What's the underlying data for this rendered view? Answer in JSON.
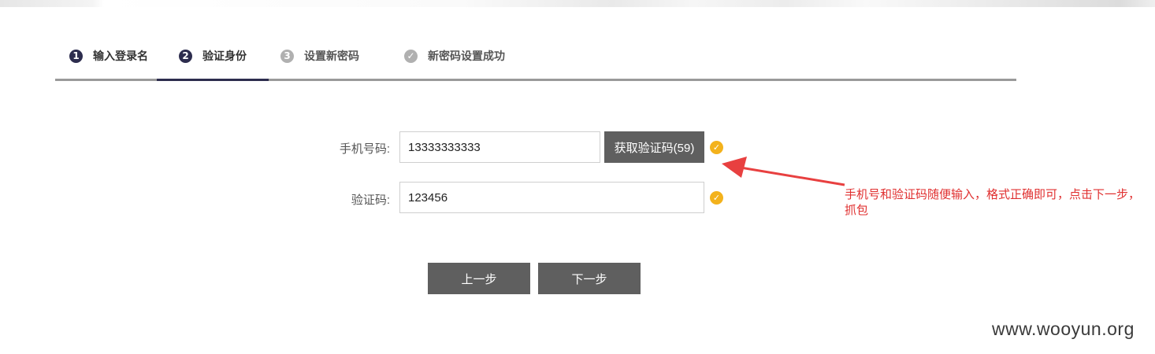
{
  "steps": [
    {
      "num": "1",
      "label": "输入登录名",
      "state": "done"
    },
    {
      "num": "2",
      "label": "验证身份",
      "state": "active"
    },
    {
      "num": "3",
      "label": "设置新密码",
      "state": "todo"
    },
    {
      "num": "✓",
      "label": "新密码设置成功",
      "state": "todo"
    }
  ],
  "form": {
    "phone_label": "手机号码:",
    "phone_value": "13333333333",
    "get_code_button": "获取验证码(59)",
    "code_label": "验证码:",
    "code_value": "123456"
  },
  "buttons": {
    "prev": "上一步",
    "next": "下一步"
  },
  "annotation": {
    "text": "手机号和验证码随便输入，格式正确即可，点击下一步，抓包"
  },
  "watermark": "www.wooyun.org",
  "colors": {
    "step_active": "#2d2d4e",
    "button_bg": "#5f5f5f",
    "check": "#f3b21c",
    "annotation": "#e03030"
  }
}
